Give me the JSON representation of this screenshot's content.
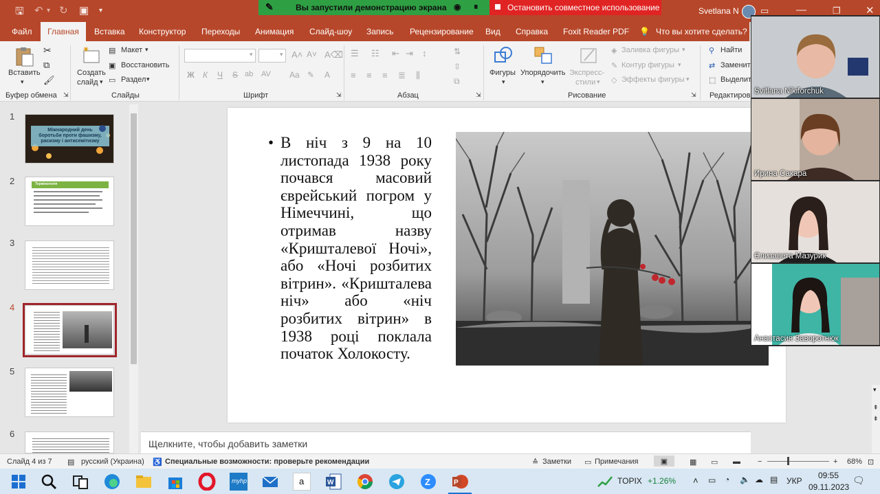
{
  "title_bar": {
    "share_banner": "Вы запустили демонстрацию экрана",
    "stop_button": "Остановить совместное использование",
    "user": "Svetlana N"
  },
  "tabs": [
    "Файл",
    "Главная",
    "Вставка",
    "Конструктор",
    "Переходы",
    "Анимация",
    "Слайд-шоу",
    "Запись",
    "Рецензирование",
    "Вид",
    "Справка",
    "Foxit Reader PDF",
    "Что вы хотите сделать?"
  ],
  "ribbon": {
    "clipboard": {
      "paste": "Вставить",
      "label": "Буфер обмена"
    },
    "slides": {
      "new_slide": "Создать",
      "new_slide2": "слайд",
      "layout": "Макет",
      "reset": "Восстановить",
      "section": "Раздел",
      "label": "Слайды"
    },
    "font": {
      "bold": "Ж",
      "italic": "К",
      "underline": "Ч",
      "strike": "S",
      "label": "Шрифт"
    },
    "paragraph": {
      "label": "Абзац"
    },
    "drawing": {
      "shapes": "Фигуры",
      "arrange": "Упорядочить",
      "quick_styles": "Экспресс-",
      "quick_styles2": "стили",
      "fill": "Заливка фигуры",
      "outline": "Контур фигуры",
      "effects": "Эффекты фигуры",
      "label": "Рисование"
    },
    "editing": {
      "find": "Найти",
      "replace": "Заменит",
      "select": "Выделит",
      "label": "Редактиров"
    }
  },
  "thumbnails": [
    {
      "num": "1",
      "title": "Міжнародний день боротьби проти фашизму, расизму і антисемітизму"
    },
    {
      "num": "2",
      "title": "Термінологія"
    },
    {
      "num": "3"
    },
    {
      "num": "4"
    },
    {
      "num": "5"
    },
    {
      "num": "6"
    }
  ],
  "slide": {
    "text": "В ніч з 9 на 10 листопада 1938 року почався масовий єврейський погром у Німеччині, що отримав назву «Кришталевої Ночі», або «Ночі розбитих вітрин». «Кришталева ніч» або «ніч розбитих вітрин» в 1938 році поклала початок Холокосту."
  },
  "notes_placeholder": "Щелкните, чтобы добавить заметки",
  "participants": [
    {
      "name": "Svitlana Nikiforchuk"
    },
    {
      "name": "Ирина Сакара"
    },
    {
      "name": "Єлизавета Мазурик"
    },
    {
      "name": "Анастасия Заворотнюк"
    }
  ],
  "status_bar": {
    "slide_info": "Слайд 4 из 7",
    "language": "русский (Украина)",
    "accessibility": "Специальные возможности: проверьте рекомендации",
    "notes": "Заметки",
    "comments": "Примечания",
    "zoom": "68%"
  },
  "taskbar": {
    "stock_name": "TOPIX",
    "stock_change": "+1.26%",
    "lang": "УКР",
    "time": "09:55",
    "date": "09.11.2023"
  },
  "colors": {
    "accent": "#b7472a",
    "share_green": "#2ea043",
    "stop_red": "#e02424",
    "thumb_selected": "#a0252a"
  }
}
